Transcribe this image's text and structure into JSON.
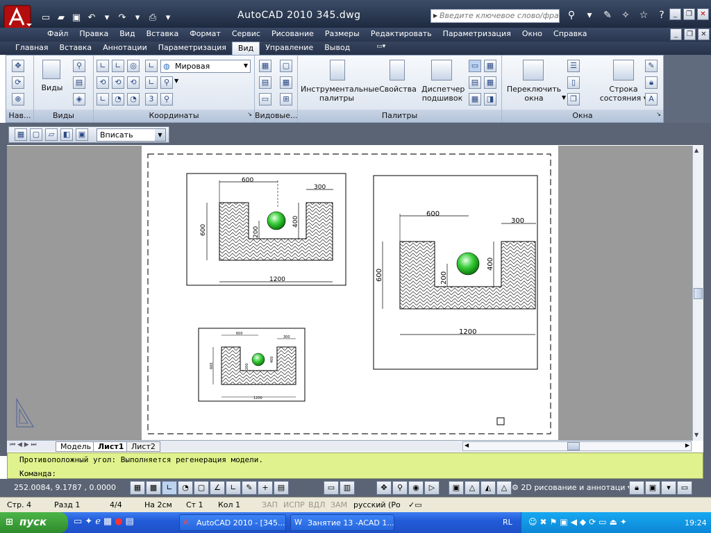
{
  "window": {
    "title": "AutoCAD 2010    345.dwg",
    "search_placeholder": "Введите ключевое слово/фразу"
  },
  "menu": [
    "Файл",
    "Правка",
    "Вид",
    "Вставка",
    "Формат",
    "Сервис",
    "Рисование",
    "Размеры",
    "Редактировать",
    "Параметризация",
    "Окно",
    "Справка"
  ],
  "ribbon_tabs": [
    {
      "label": "Главная",
      "active": false
    },
    {
      "label": "Вставка",
      "active": false
    },
    {
      "label": "Аннотации",
      "active": false
    },
    {
      "label": "Параметризация",
      "active": false
    },
    {
      "label": "Вид",
      "active": true
    },
    {
      "label": "Управление",
      "active": false
    },
    {
      "label": "Вывод",
      "active": false
    }
  ],
  "ribbon": {
    "panels": {
      "nav": "Нав...",
      "views": "Виды",
      "coords": "Координаты",
      "viewports": "Видовые...",
      "palettes": "Палитры",
      "windows": "Окна"
    },
    "views_button": "Виды",
    "ucs_value": "Мировая",
    "tool_palettes": [
      "Инструментальные",
      "палитры"
    ],
    "properties": "Свойства",
    "sheet_manager": [
      "Диспетчер",
      "подшивок"
    ],
    "switch_windows": [
      "Переключить",
      "окна"
    ],
    "status_line": [
      "Строка",
      "состояния"
    ]
  },
  "viewport_toolbar": {
    "scale_value": "Вписать"
  },
  "drawing": {
    "dims_large": {
      "top": "600",
      "right": "300",
      "left": "600",
      "inner_h": "400",
      "inner_v": "200",
      "bottom": "1200"
    },
    "dims_small": {
      "top": "600",
      "right": "300",
      "left": "600",
      "inner_h": "400",
      "inner_v": "200",
      "bottom": "1200"
    }
  },
  "layout_tabs": [
    "Модель",
    "Лист1",
    "Лист2"
  ],
  "command": {
    "line1": "Противоположный угол: Выполняется регенерация модели.",
    "line2": "Команда:"
  },
  "status": {
    "coords": "252.0084, 9.1787  , 0.0000",
    "workspace": "2D рисование и аннотаци"
  },
  "word_status": {
    "page": "Стр. 4",
    "section": "Разд 1",
    "pages": "4/4",
    "at": "На 2см",
    "line": "Ст 1",
    "col": "Кол 1",
    "rec": "ЗАП",
    "trk": "ИСПР",
    "ext": "ВДЛ",
    "ovr": "ЗАМ",
    "lang": "русский (Ро"
  },
  "taskbar": {
    "start": "пуск",
    "tasks": [
      "AutoCAD 2010 - [345...",
      "Занятие 13 -ACAD 1..."
    ],
    "lang": "RL",
    "clock": "19:24"
  }
}
